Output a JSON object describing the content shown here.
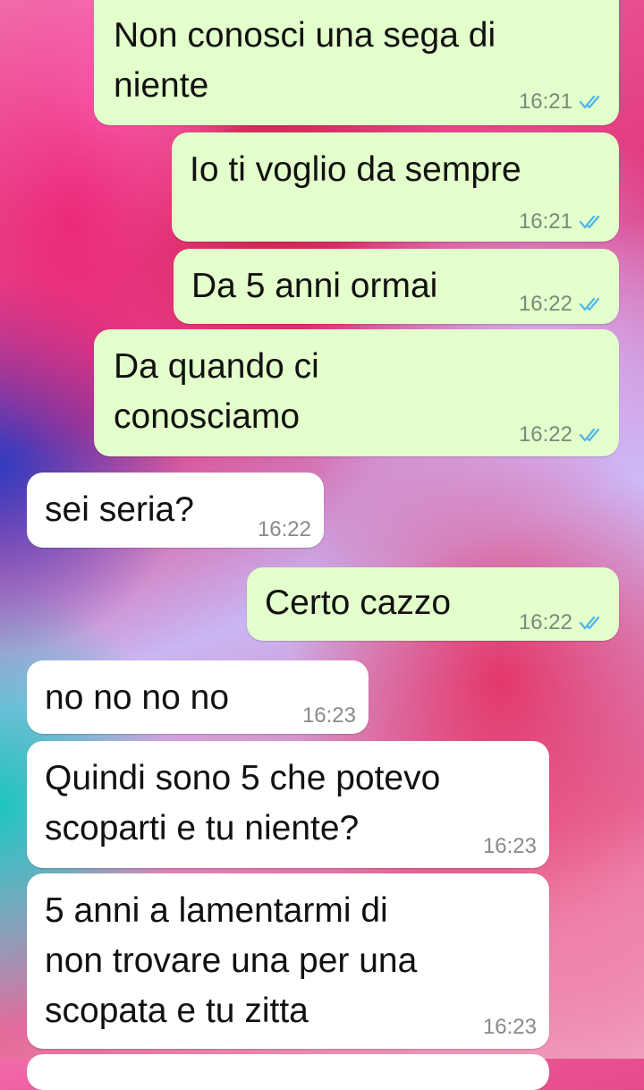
{
  "messages": [
    {
      "direction": "outgoing",
      "text": "Non conosci una sega di\nniente",
      "time": "16:21",
      "status": "read-double-check-icon"
    },
    {
      "direction": "outgoing",
      "text": "Io ti voglio da sempre",
      "time": "16:21",
      "status": "read-double-check-icon"
    },
    {
      "direction": "outgoing",
      "text": "Da 5 anni ormai",
      "time": "16:22",
      "status": "read-double-check-icon"
    },
    {
      "direction": "outgoing",
      "text": "Da quando ci\nconosciamo",
      "time": "16:22",
      "status": "read-double-check-icon"
    },
    {
      "direction": "incoming",
      "text": "sei seria?",
      "time": "16:22"
    },
    {
      "direction": "outgoing",
      "text": "Certo cazzo",
      "time": "16:22",
      "status": "read-double-check-icon"
    },
    {
      "direction": "incoming",
      "text": "no no no no",
      "time": "16:23"
    },
    {
      "direction": "incoming",
      "text": "Quindi sono 5 che potevo\nscoparti e tu niente?",
      "time": "16:23"
    },
    {
      "direction": "incoming",
      "text": "5 anni a lamentarmi di\nnon trovare una per una\nscopata e tu zitta",
      "time": "16:23"
    }
  ],
  "colors": {
    "outgoing_bubble": "#e3ffcb",
    "incoming_bubble": "#ffffff",
    "read_ticks": "#4fb6ec"
  }
}
